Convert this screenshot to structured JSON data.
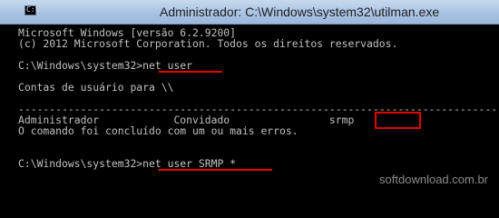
{
  "titlebar": {
    "title": "Administrador: C:\\Windows\\system32\\utilman.exe",
    "icon": "console-icon",
    "icon_glyph": "C:\\"
  },
  "console": {
    "lines": [
      "Microsoft Windows [versão 6.2.9200]",
      "(c) 2012 Microsoft Corporation. Todos os direitos reservados.",
      "",
      "C:\\Windows\\system32>net user",
      "",
      "Contas de usuário para \\\\",
      "",
      "-------------------------------------------------------------------------------",
      "Administrador            Convidado                srmp",
      "O comando foi concluído com um ou mais erros.",
      "",
      "",
      "C:\\Windows\\system32>net user SRMP *"
    ]
  },
  "highlight_color": "#e60000",
  "console_text_color": "#c0c0c0",
  "watermark": "softdownload.com.br"
}
